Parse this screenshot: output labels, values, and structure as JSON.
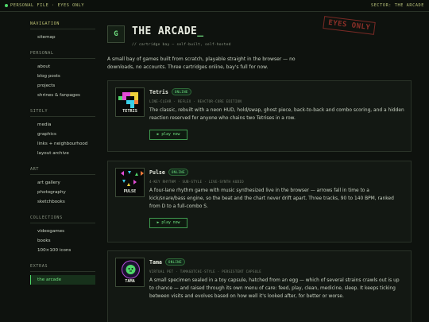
{
  "topbar": {
    "left": "PERSONAL FILE · EYES ONLY",
    "right": "SECTOR: THE ARCADE"
  },
  "sidebar": {
    "sections": [
      {
        "heading": "NAVIGATION",
        "items": [
          "sitemap"
        ]
      },
      {
        "heading": "PERSONAL",
        "items": [
          "about",
          "blog posts",
          "projects",
          "shrines & fanpages"
        ]
      },
      {
        "heading": "SITELY",
        "items": [
          "media",
          "graphics",
          "links + neighbourhood",
          "layout archive"
        ]
      },
      {
        "heading": "ART",
        "items": [
          "art gallery",
          "photography",
          "sketchbooks"
        ]
      },
      {
        "heading": "COLLECTIONS",
        "items": [
          "videogames",
          "books",
          "100×100 icons"
        ]
      },
      {
        "heading": "EXTRAS",
        "items": [
          "the arcade"
        ]
      }
    ],
    "active": "the arcade"
  },
  "hero": {
    "logo_letter": "G",
    "title": "THE ARCADE",
    "cursor": "_",
    "subtitle": "// cartridge bay — self-built, self-hosted",
    "stamp": "EYES ONLY",
    "intro": "A small bay of games built from scratch, playable straight in the browser — no downloads, no accounts. Three cartridges online, bay's full for now."
  },
  "games": [
    {
      "thumb_label": "TETRIS",
      "title": "Tetris",
      "status": "ONLINE",
      "tags": "LINE-CLEAR · REFLEX · REACTOR-CORE EDITION",
      "description": "The classic, rebuilt with a neon HUD, hold/swap, ghost piece, back-to-back and combo scoring, and a hidden reaction reserved for anyone who chains two Tetrises in a row.",
      "play_label": "▶ play now"
    },
    {
      "thumb_label": "PULSE",
      "title": "Pulse",
      "status": "ONLINE",
      "tags": "4-KEY RHYTHM · SUB-STYLE · LIVE-SYNTH AUDIO",
      "description": "A four-lane rhythm game with music synthesized live in the browser — arrows fall in time to a kick/snare/bass engine, so the beat and the chart never drift apart. Three tracks, 90 to 140 BPM, ranked from D to a full-combo S.",
      "play_label": "▶ play now"
    },
    {
      "thumb_label": "TAMA",
      "title": "Tama",
      "status": "ONLINE",
      "tags": "VIRTUAL PET · TAMAGOTCHI-STYLE · PERSISTENT CAPSULE",
      "description": "A small specimen sealed in a toy capsule, hatched from an egg — which of several strains crawls out is up to chance — and raised through its own menu of care: feed, play, clean, medicine, sleep. It keeps ticking between visits and evolves based on how well it's looked after, for better or worse.",
      "play_label": "▶ play now"
    }
  ],
  "colors": {
    "background": "#0e120e",
    "accent": "#6fe07f",
    "stamp": "#8c2f28",
    "heading": "#c6c978"
  }
}
